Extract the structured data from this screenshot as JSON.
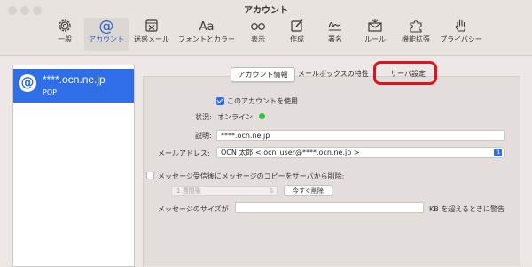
{
  "window": {
    "title": "アカウント"
  },
  "toolbar": {
    "items": [
      {
        "label": "一般",
        "icon": "gear-icon"
      },
      {
        "label": "アカウント",
        "icon": "at-sign-icon",
        "selected": true
      },
      {
        "label": "迷惑メール",
        "icon": "junk-tray-icon"
      },
      {
        "label": "フォントとカラー",
        "icon": "font-aa-icon"
      },
      {
        "label": "表示",
        "icon": "glasses-icon"
      },
      {
        "label": "作成",
        "icon": "compose-icon"
      },
      {
        "label": "署名",
        "icon": "signature-icon"
      },
      {
        "label": "ルール",
        "icon": "rules-envelope-icon"
      },
      {
        "label": "機能拡張",
        "icon": "puzzle-icon"
      },
      {
        "label": "プライバシー",
        "icon": "hand-icon"
      }
    ]
  },
  "sidebar": {
    "account": {
      "name": "****.ocn.ne.jp",
      "type": "POP",
      "icon": "at-sign-icon"
    }
  },
  "tabs": {
    "account_info": "アカウント情報",
    "mailbox": "メールボックスの特性",
    "server": "サーバ設定"
  },
  "form": {
    "enable_label": "このアカウントを使用",
    "enable_checked": true,
    "status_label": "状況:",
    "status_value": "オンライン",
    "status_color": "#27c93f",
    "description_label": "説明:",
    "description_value": "****.ocn.ne.jp",
    "email_label": "メールアドレス:",
    "email_value": "OCN 太郎 < ocn_user@****.ocn.ne.jp >",
    "delete_label": "メッセージ受信後にメッセージのコピーをサーバから削除:",
    "delete_checked": false,
    "period_value": "1 週間後",
    "delete_now_label": "今すぐ削除",
    "size_label": "メッセージのサイズが",
    "size_value": "",
    "size_suffix": "KB を超えるときに警告"
  },
  "colors": {
    "accent": "#2f6ee6",
    "highlight": "#e3111b"
  }
}
